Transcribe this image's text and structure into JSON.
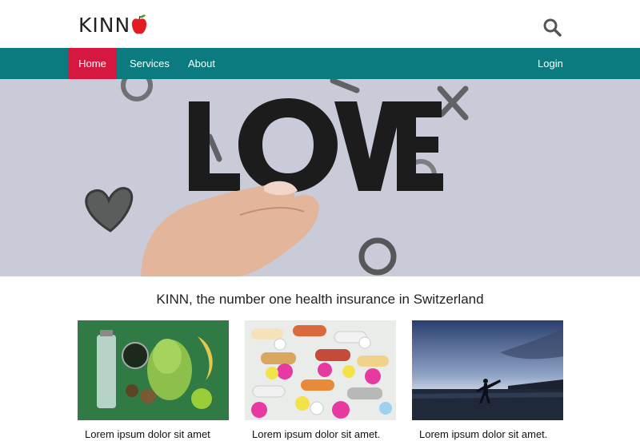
{
  "header": {
    "logo_text": "KINN",
    "logo_icon": "apple-icon",
    "search_icon": "search-icon"
  },
  "nav": {
    "items": [
      {
        "label": "Home",
        "active": true
      },
      {
        "label": "Services",
        "active": false
      },
      {
        "label": "About",
        "active": false
      }
    ],
    "login_label": "Login"
  },
  "hero": {
    "word": "LOVE"
  },
  "main": {
    "tagline": "KINN, the number one health insurance in Switzerland",
    "cards": [
      {
        "caption": "Lorem ipsum dolor sit amet",
        "image": "healthy-food-photo"
      },
      {
        "caption": "Lorem ipsum dolor sit amet.",
        "image": "pills-photo"
      },
      {
        "caption": "Lorem ipsum dolor sit amet.",
        "image": "beach-karate-photo"
      }
    ]
  },
  "colors": {
    "nav_bg": "#0c7b7f",
    "active_nav": "#d6173f",
    "hero_bg": "#c9ccd8"
  }
}
